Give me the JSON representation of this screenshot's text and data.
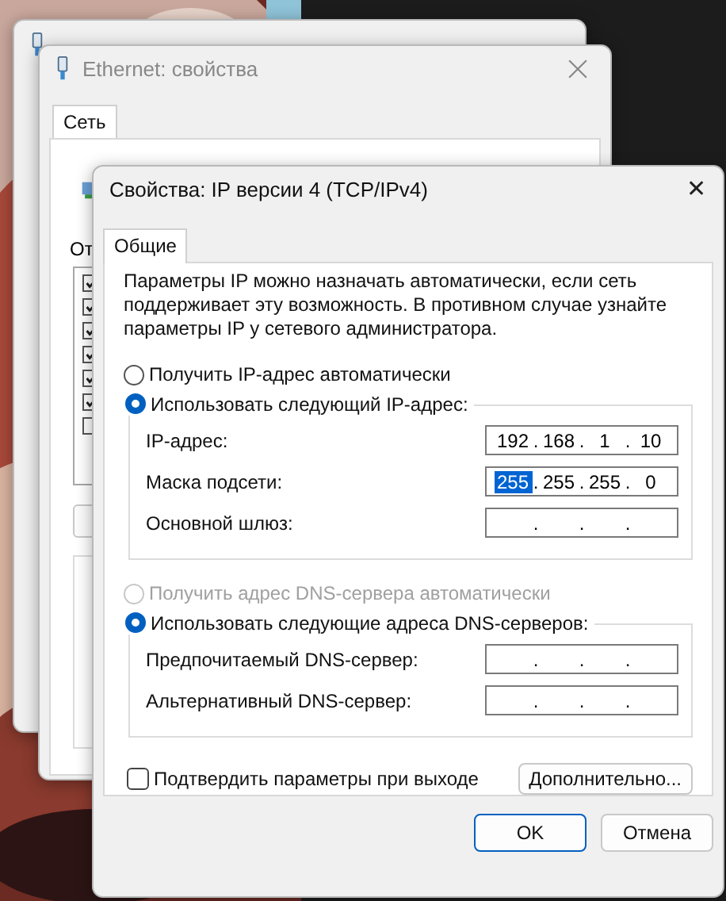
{
  "properties_window": {
    "title": "Ethernet: свойства",
    "tabs": [
      {
        "label": "Сеть",
        "selected": true
      }
    ],
    "components_label": "От",
    "components": [
      {
        "checked": true
      },
      {
        "checked": true
      },
      {
        "checked": true
      },
      {
        "checked": true
      },
      {
        "checked": true
      },
      {
        "checked": true
      },
      {
        "checked": false
      }
    ]
  },
  "dialog": {
    "title": "Свойства: IP версии 4 (TCP/IPv4)",
    "close": "✕",
    "tabs": [
      {
        "label": "Общие",
        "selected": true
      }
    ],
    "description": "Параметры IP можно назначать автоматически, если сеть поддерживает эту возможность. В противном случае узнайте параметры IP у сетевого администратора.",
    "separator": ".",
    "ip_mode": [
      {
        "label": "Получить IP-адрес автоматически",
        "selected": false,
        "disabled": false
      },
      {
        "label": "Использовать следующий IP-адрес:",
        "selected": true,
        "disabled": false
      }
    ],
    "ip_fields": [
      {
        "label": "IP-адрес:",
        "octets": [
          {
            "text": "192",
            "selected": false
          },
          {
            "text": "168",
            "selected": false
          },
          {
            "text": "1",
            "selected": false
          },
          {
            "text": "10",
            "selected": false
          }
        ]
      },
      {
        "label": "Маска подсети:",
        "octets": [
          {
            "text": "255",
            "selected": true
          },
          {
            "text": "255",
            "selected": false
          },
          {
            "text": "255",
            "selected": false
          },
          {
            "text": "0",
            "selected": false
          }
        ]
      },
      {
        "label": "Основной шлюз:"
      }
    ],
    "dns_mode": [
      {
        "label": "Получить адрес DNS-сервера автоматически",
        "selected": false,
        "disabled": true
      },
      {
        "label": "Использовать следующие адреса DNS-серверов:",
        "selected": true,
        "disabled": false
      }
    ],
    "dns_fields": [
      {
        "label": "Предпочитаемый DNS-сервер:"
      },
      {
        "label": "Альтернативный DNS-сервер:"
      }
    ],
    "validate": {
      "label": "Подтвердить параметры при выходе",
      "checked": false
    },
    "advanced_button": "Дополнительно...",
    "buttons": [
      {
        "label": "OK",
        "kind": "default"
      },
      {
        "label": "Отмена",
        "kind": "normal"
      }
    ]
  }
}
